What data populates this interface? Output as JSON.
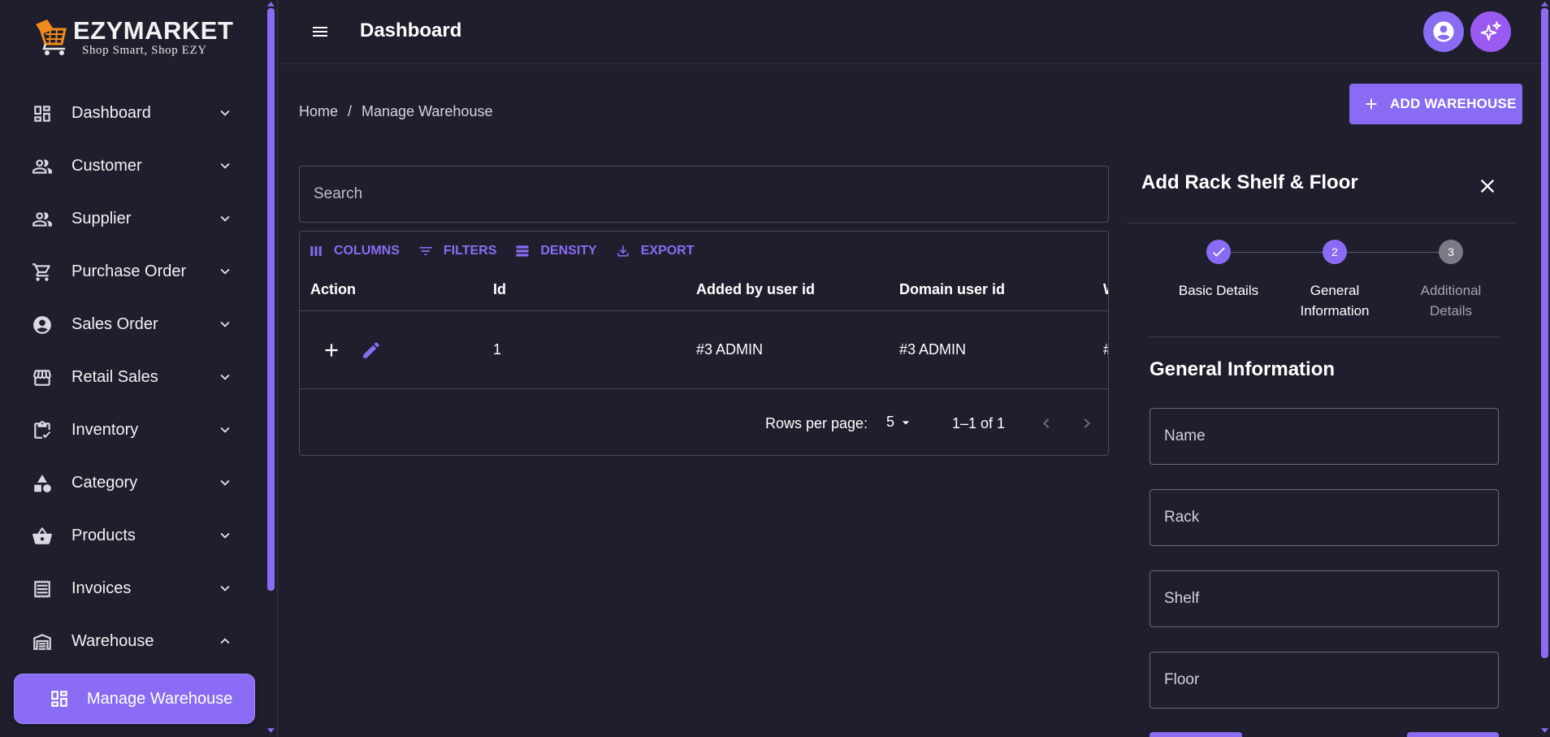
{
  "brand": {
    "name": "EZYMARKET",
    "tagline": "Shop Smart, Shop EZY"
  },
  "sidebar": {
    "items": [
      {
        "label": "Dashboard",
        "icon": "dashboard-icon",
        "expanded": false
      },
      {
        "label": "Customer",
        "icon": "people-icon",
        "expanded": false
      },
      {
        "label": "Supplier",
        "icon": "people-icon",
        "expanded": false
      },
      {
        "label": "Purchase Order",
        "icon": "cart-icon",
        "expanded": false
      },
      {
        "label": "Sales Order",
        "icon": "account-circle-icon",
        "expanded": false
      },
      {
        "label": "Retail Sales",
        "icon": "store-icon",
        "expanded": false
      },
      {
        "label": "Inventory",
        "icon": "clipboard-check-icon",
        "expanded": false
      },
      {
        "label": "Category",
        "icon": "category-shapes-icon",
        "expanded": false
      },
      {
        "label": "Products",
        "icon": "basket-icon",
        "expanded": false
      },
      {
        "label": "Invoices",
        "icon": "receipt-icon",
        "expanded": false
      },
      {
        "label": "Warehouse",
        "icon": "warehouse-icon",
        "expanded": true
      }
    ],
    "active_sub_item": "Manage Warehouse"
  },
  "topbar": {
    "title": "Dashboard"
  },
  "breadcrumb": {
    "home": "Home",
    "separator": "/",
    "current": "Manage Warehouse"
  },
  "actions": {
    "add_warehouse": "ADD WAREHOUSE"
  },
  "search": {
    "placeholder": "Search"
  },
  "grid": {
    "toolbar": {
      "columns": "COLUMNS",
      "filters": "FILTERS",
      "density": "DENSITY",
      "export": "EXPORT"
    },
    "headers": [
      "Action",
      "Id",
      "Added by user id",
      "Domain user id",
      "W"
    ],
    "rows": [
      {
        "id": "1",
        "added_by": "#3 ADMIN",
        "domain_user": "#3 ADMIN",
        "w": "#"
      }
    ],
    "footer": {
      "rows_per_page_label": "Rows per page:",
      "rows_per_page_value": "5",
      "range": "1–1 of 1"
    }
  },
  "drawer": {
    "title": "Add Rack Shelf & Floor",
    "steps": [
      {
        "num": "1",
        "line1": "Basic Details",
        "line2": "",
        "state": "completed"
      },
      {
        "num": "2",
        "line1": "General",
        "line2": "Information",
        "state": "active"
      },
      {
        "num": "3",
        "line1": "Additional",
        "line2": "Details",
        "state": "pending"
      }
    ],
    "section_title": "General Information",
    "fields": {
      "name": "Name",
      "rack": "Rack",
      "shelf": "Shelf",
      "floor": "Floor"
    }
  },
  "colors": {
    "accent": "#8a6cf4",
    "background": "#1f1e2c",
    "ai_button": "#9a59f0"
  }
}
